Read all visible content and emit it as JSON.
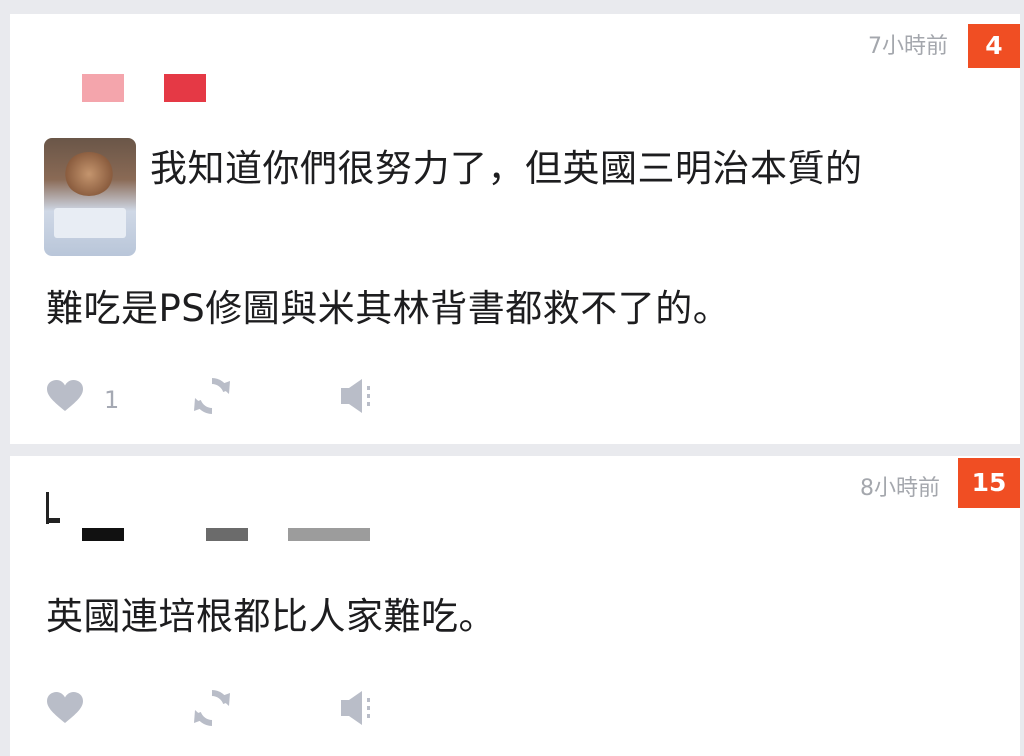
{
  "comments": [
    {
      "timestamp": "7小時前",
      "score": "4",
      "text_line1": "我知道你們很努力了，但英國三明治本質的",
      "text_line2": "難吃是PS修圖與米其林背書都救不了的。",
      "like_count": "1"
    },
    {
      "timestamp": "8小時前",
      "score": "15",
      "text": "英國連培根都比人家難吃。",
      "like_count": ""
    }
  ],
  "colors": {
    "badge": "#f04e23",
    "icon": "#b9bdc8",
    "timestamp": "#a4a7ad",
    "text": "#1d1d1f",
    "background": "#e9eaee"
  },
  "icons": {
    "like": "heart-icon",
    "share": "refresh-icon",
    "report": "speaker-icon"
  }
}
